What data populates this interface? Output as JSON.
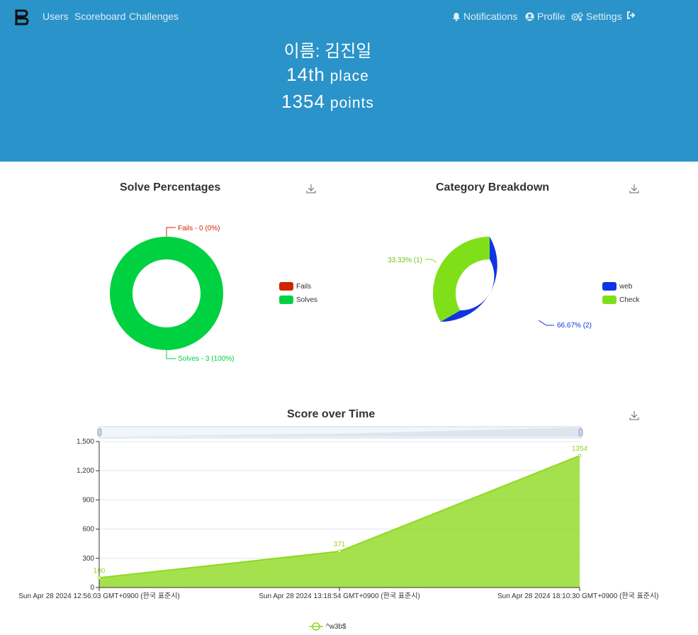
{
  "nav": {
    "links": [
      "Users",
      "Scoreboard",
      "Challenges"
    ],
    "notifications": "Notifications",
    "profile": "Profile",
    "settings": "Settings"
  },
  "hero": {
    "name": "이름: 김진일",
    "place_num": "14th",
    "place_label": "place",
    "points_num": "1354",
    "points_label": "points",
    "color": "#2a93c9"
  },
  "solve": {
    "title": "Solve Percentages",
    "fail_label": "Fails - 0 (0%)",
    "solve_label": "Solves - 3 (100%)",
    "legend_fails": "Fails",
    "legend_solves": "Solves",
    "fail_color": "#cf2600",
    "solve_color": "#00d140"
  },
  "category": {
    "title": "Category Breakdown",
    "web_label": "66.67% (2)",
    "check_label": "33.33% (1)",
    "legend_web": "web",
    "legend_check": "Check",
    "web_color": "#1034e0",
    "check_color": "#7fe01a"
  },
  "score": {
    "title": "Score over Time",
    "legend": "^w3b$",
    "color": "#8fd920"
  },
  "chart_data": [
    {
      "type": "pie",
      "title": "Solve Percentages",
      "categories": [
        "Fails",
        "Solves"
      ],
      "values": [
        0,
        3
      ],
      "labels": [
        "Fails - 0 (0%)",
        "Solves - 3 (100%)"
      ],
      "legend": "right"
    },
    {
      "type": "pie",
      "title": "Category Breakdown",
      "categories": [
        "web",
        "Check"
      ],
      "values": [
        2,
        1
      ],
      "labels": [
        "66.67% (2)",
        "33.33% (1)"
      ],
      "legend": "right"
    },
    {
      "type": "area",
      "title": "Score over Time",
      "x": [
        "Sun Apr 28 2024 12:56:03 GMT+0900 (한국 표준시)",
        "Sun Apr 28 2024 13:18:54 GMT+0900 (한국 표준시)",
        "Sun Apr 28 2024 18:10:30 GMT+0900 (한국 표준시)"
      ],
      "series": [
        {
          "name": "^w3b$",
          "values": [
            100,
            371,
            1354
          ]
        }
      ],
      "ylim": [
        0,
        1500
      ],
      "yticks": [
        "0",
        "300",
        "600",
        "900",
        "1,200",
        "1,500"
      ],
      "grid": true,
      "legend": "bottom"
    }
  ]
}
